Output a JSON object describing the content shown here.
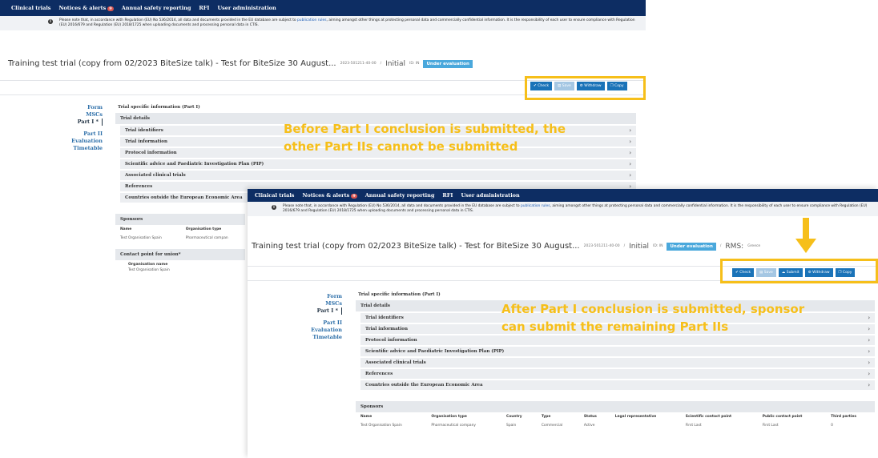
{
  "nav": {
    "items": [
      "Clinical trials",
      "Notices & alerts",
      "Annual safety reporting",
      "RFI",
      "User administration"
    ],
    "alerts_badge": "9"
  },
  "notice1": {
    "before": "Please note that, in accordance with Regulation (EU) No 536/2014, all data and documents provided in the EU database are subject to ",
    "link": "publication rules",
    "after": ", aiming amongst other things at protecting personal data and commercially confidential information. It is the responsibility of each user to ensure compliance with Regulation (EU) 2016/679 and Regulation (EU) 2018/1725 when uploading documents and processing personal data in CTIS."
  },
  "trial": {
    "title": "Training test trial (copy from 02/2023 BiteSize talk) - Test for BiteSize 30 August...",
    "number": "2023-501211-40-00",
    "slash": "/",
    "phase": "Initial",
    "id_label": "ID: IN",
    "status": "Under evaluation",
    "rms_label": "RMS:",
    "rms_value": "Greece"
  },
  "buttons": {
    "check": "✔ Check",
    "save": "▤ Save",
    "submit": "☁ Submit",
    "withdraw": "⚙ Withdraw",
    "copy": "❐ Copy"
  },
  "sidenav": {
    "form": "Form",
    "mscs": "MSCs",
    "part1": "Part I *",
    "part2": "Part II",
    "evaluation": "Evaluation",
    "timetable": "Timetable"
  },
  "part1": {
    "header": "Trial specific information (Part I)",
    "group": "Trial details",
    "rows": [
      "Trial identifiers",
      "Trial information",
      "Protocol information",
      "Scientific advice and Paediatric Investigation Plan (PIP)",
      "Associated clinical trials",
      "References",
      "Countries outside the European Economic Area"
    ],
    "sponsors": "Sponsors",
    "contact": "Contact point for union*",
    "org_name_label": "Organisation name",
    "org_name_value": "Test Organisation Spain"
  },
  "sponsors_table": {
    "headers_short": [
      "Name",
      "Organisation type"
    ],
    "headers": [
      "Name",
      "Organisation type",
      "Country",
      "Type",
      "Status",
      "Legal representative",
      "Scientific contact point",
      "Public contact point",
      "Third parties"
    ],
    "row": [
      "Test Organisation Spain",
      "Pharmaceutical company",
      "Spain",
      "Commercial",
      "Active",
      "",
      "First Last",
      "First Last",
      "0"
    ],
    "row_short": [
      "Test Organisation Spain",
      "Pharmaceutical compan"
    ]
  },
  "annotations": {
    "before_line1": "Before Part I conclusion is submitted, the",
    "before_line2": "other Part IIs cannot be submitted",
    "after_line1": "After Part I conclusion is submitted, sponsor",
    "after_line2": "can submit the remaining Part IIs"
  },
  "colors": {
    "nav_bg": "#0d2d63",
    "button": "#1a73b8",
    "status": "#4aa8dc",
    "annotation": "#f6bf1a"
  }
}
